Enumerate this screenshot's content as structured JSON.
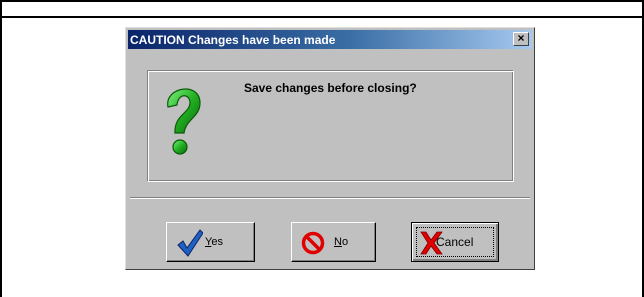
{
  "dialog": {
    "title": "CAUTION Changes have been made",
    "close_glyph": "×",
    "message": "Save changes before closing?",
    "message_icon": "question-mark-icon",
    "buttons": [
      {
        "mnemonic": "Y",
        "rest": "es",
        "icon": "checkmark-icon",
        "icon_color": "#2060c0",
        "default": false
      },
      {
        "mnemonic": "N",
        "rest": "o",
        "icon": "no-entry-icon",
        "icon_color": "#e00000",
        "default": false
      },
      {
        "label": "Cancel",
        "icon": "red-x-icon",
        "icon_color": "#e00000",
        "default": true
      }
    ]
  },
  "colors": {
    "face": "#c0c0c0",
    "titlebar_start": "#0a246a",
    "titlebar_end": "#a6caf0",
    "question_mark": "#22b022"
  }
}
